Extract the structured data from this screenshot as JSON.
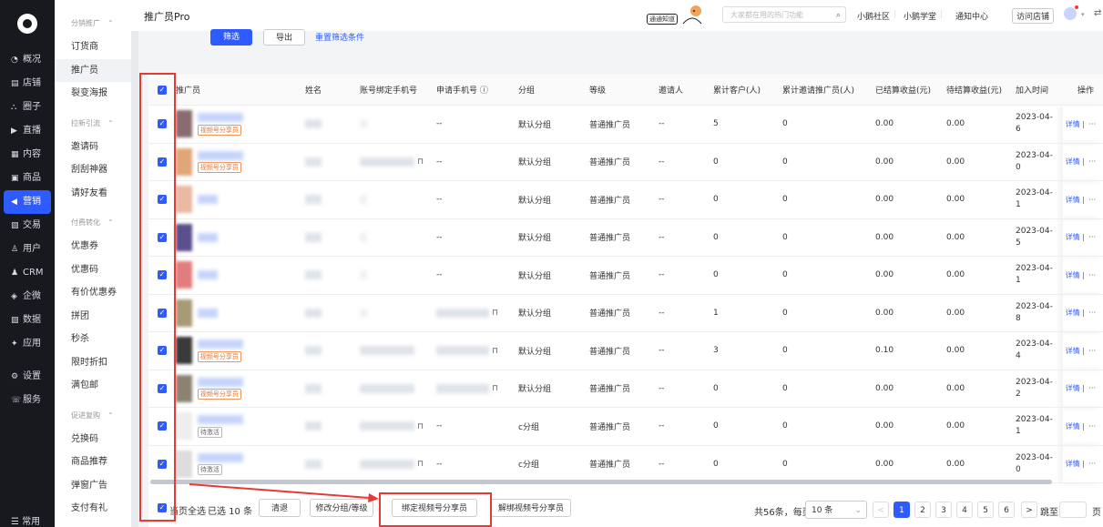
{
  "nav": {
    "items": [
      {
        "icon": "◔",
        "label": "概况"
      },
      {
        "icon": "▤",
        "label": "店铺"
      },
      {
        "icon": "⛬",
        "label": "圈子"
      },
      {
        "icon": "▶",
        "label": "直播"
      },
      {
        "icon": "▦",
        "label": "内容"
      },
      {
        "icon": "▣",
        "label": "商品"
      },
      {
        "icon": "◀",
        "label": "营销"
      },
      {
        "icon": "▧",
        "label": "交易"
      },
      {
        "icon": "♙",
        "label": "用户"
      },
      {
        "icon": "♟",
        "label": "CRM"
      },
      {
        "icon": "◈",
        "label": "企微"
      },
      {
        "icon": "▨",
        "label": "数据"
      },
      {
        "icon": "✦",
        "label": "应用"
      },
      {
        "icon": "⚙",
        "label": "设置"
      },
      {
        "icon": "☏",
        "label": "服务"
      }
    ],
    "bottom": "☰ 常用"
  },
  "sub": {
    "groups": [
      {
        "title": "分销推广",
        "items": [
          "订货商",
          "推广员",
          "裂变海报"
        ]
      },
      {
        "title": "拉新引流",
        "items": [
          "邀请码",
          "刮刮神器",
          "请好友看"
        ]
      },
      {
        "title": "付费转化",
        "items": [
          "优惠券",
          "优惠码",
          "有价优惠券",
          "拼团",
          "秒杀",
          "限时折扣",
          "满包邮"
        ]
      },
      {
        "title": "促进复购",
        "items": [
          "兑换码",
          "商品推荐",
          "弹窗广告",
          "支付有礼"
        ]
      }
    ]
  },
  "header": {
    "title": "推广员Pro",
    "badge": "通通知道",
    "search_placeholder": "大家都在用的热门功能",
    "links": [
      "小鹅社区",
      "小鹅学堂",
      "通知中心"
    ],
    "visit": "访问店铺"
  },
  "filter": {
    "filter_btn": "筛选",
    "export_btn": "导出",
    "reset_link": "重置筛选条件"
  },
  "table": {
    "columns": [
      "推广员",
      "姓名",
      "账号绑定手机号",
      "申请手机号 ⓘ",
      "分组",
      "等级",
      "邀请人",
      "累计客户(人)",
      "累计邀请推广员(人)",
      "已结算收益(元)",
      "待结算收益(元)",
      "加入时间",
      "操作"
    ],
    "rows": [
      {
        "tag": "视频号分享员",
        "tagtype": "o",
        "apply": "--",
        "group": "默认分组",
        "level": "普通推广员",
        "inviter": "--",
        "customers": "5",
        "invited": "0",
        "settled": "0.00",
        "pending": "0.00",
        "date": "2023-04-",
        "date2": "6",
        "thumb": "#8a6b70",
        "bind": "none",
        "lock": false
      },
      {
        "tag": "视频号分享员",
        "tagtype": "o",
        "apply": "--",
        "group": "默认分组",
        "level": "普通推广员",
        "inviter": "--",
        "customers": "0",
        "invited": "0",
        "settled": "0.00",
        "pending": "0.00",
        "date": "2023-04-",
        "date2": "0",
        "thumb": "#e0a678",
        "bind": "blur",
        "lock": true
      },
      {
        "tag": "",
        "tagtype": "",
        "apply": "--",
        "group": "默认分组",
        "level": "普通推广员",
        "inviter": "--",
        "customers": "0",
        "invited": "0",
        "settled": "0.00",
        "pending": "0.00",
        "date": "2023-04-",
        "date2": "1",
        "thumb": "#e9b9a3",
        "bind": "none",
        "lock": false
      },
      {
        "tag": "",
        "tagtype": "",
        "apply": "--",
        "group": "默认分组",
        "level": "普通推广员",
        "inviter": "--",
        "customers": "0",
        "invited": "0",
        "settled": "0.00",
        "pending": "0.00",
        "date": "2023-04-",
        "date2": "5",
        "thumb": "#5a4f8c",
        "bind": "none",
        "lock": false
      },
      {
        "tag": "",
        "tagtype": "",
        "apply": "--",
        "group": "默认分组",
        "level": "普通推广员",
        "inviter": "--",
        "customers": "0",
        "invited": "0",
        "settled": "0.00",
        "pending": "0.00",
        "date": "2023-04-",
        "date2": "1",
        "thumb": "#e37d7d",
        "bind": "none",
        "lock": false
      },
      {
        "tag": "",
        "tagtype": "",
        "apply": "",
        "group": "默认分组",
        "level": "普通推广员",
        "inviter": "--",
        "customers": "1",
        "invited": "0",
        "settled": "0.00",
        "pending": "0.00",
        "date": "2023-04-",
        "date2": "8",
        "thumb": "#a99a77",
        "bind": "none",
        "lock2": true
      },
      {
        "tag": "视频号分享员",
        "tagtype": "o",
        "apply": "",
        "group": "默认分组",
        "level": "普通推广员",
        "inviter": "--",
        "customers": "3",
        "invited": "0",
        "settled": "0.10",
        "pending": "0.00",
        "date": "2023-04-",
        "date2": "4",
        "thumb": "#3a3a3a",
        "bind": "blur",
        "lock2": true
      },
      {
        "tag": "视频号分享员",
        "tagtype": "o",
        "apply": "",
        "group": "默认分组",
        "level": "普通推广员",
        "inviter": "--",
        "customers": "0",
        "invited": "0",
        "settled": "0.00",
        "pending": "0.00",
        "date": "2023-04-",
        "date2": "2",
        "thumb": "#8c8272",
        "bind": "blur",
        "lock2": true
      },
      {
        "tag": "待激活",
        "tagtype": "g",
        "apply": "--",
        "group": "c分组",
        "level": "普通推广员",
        "inviter": "--",
        "customers": "0",
        "invited": "0",
        "settled": "0.00",
        "pending": "0.00",
        "date": "2023-04-",
        "date2": "1",
        "thumb": "#eeeeee",
        "bind": "blur",
        "lock": true
      },
      {
        "tag": "待激活",
        "tagtype": "g",
        "apply": "--",
        "group": "c分组",
        "level": "普通推广员",
        "inviter": "--",
        "customers": "0",
        "invited": "0",
        "settled": "0.00",
        "pending": "0.00",
        "date": "2023-04-",
        "date2": "0",
        "thumb": "#dddddd",
        "bind": "blur",
        "lock": true
      }
    ],
    "op_detail": "详情",
    "op_more": "···"
  },
  "footer": {
    "select_page": "当页全选",
    "selected": "已选 10 条",
    "clear": "清退",
    "modify": "修改分组/等级",
    "bind_video": "绑定视频号分享员",
    "unbind_video": "解绑视频号分享员",
    "total": "共56条，每页",
    "page_size": "10 条",
    "pages": [
      "1",
      "2",
      "3",
      "4",
      "5",
      "6"
    ],
    "prev": "<",
    "next": ">",
    "jump": "跳至",
    "page_suffix": "页"
  },
  "colors": {
    "accent": "#2e5bff",
    "annotation": "#e53a35"
  }
}
